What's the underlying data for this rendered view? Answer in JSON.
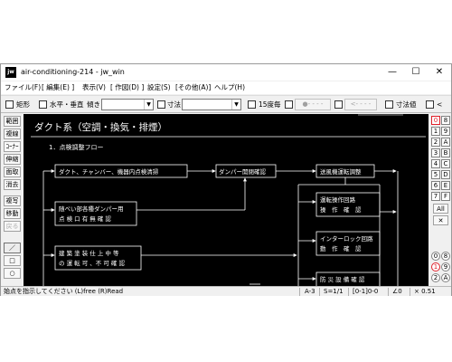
{
  "window": {
    "app_icon": "jw",
    "title": "air-conditioning-214 - jw_win",
    "buttons": {
      "minimize": "—",
      "maximize": "☐",
      "close": "✕"
    }
  },
  "menu": [
    "ファイル(F)",
    "[ 編集(E) ]",
    "表示(V)",
    "[ 作図(D) ]",
    "設定(S)",
    "[その他(A)]",
    "ヘルプ(H)"
  ],
  "toolbar": {
    "rect_label": "矩形",
    "horiz_vert_label": "水平・垂直",
    "tilt_label": "傾き",
    "tilt_value": "",
    "dim_label": "寸法",
    "dim_value": "",
    "scale_label": "15度毎",
    "circle_btn": "●- - - -",
    "arrow_btn": "<- - - -",
    "dim_value_label": "寸法値",
    "lt_label": "<"
  },
  "left_tools": [
    "範囲",
    "複線",
    "ｺｰﾅｰ",
    "伸縮",
    "面取",
    "消去",
    "複写",
    "移動",
    "戻る",
    "／",
    "□",
    "○"
  ],
  "right_tools": {
    "layer_groups_top": [
      "0",
      "1",
      "2",
      "3",
      "4",
      "5",
      "6",
      "7"
    ],
    "layer_groups_right": [
      "8",
      "9",
      "A",
      "B",
      "C",
      "D",
      "E",
      "F"
    ],
    "all_label": "All",
    "x_label": "✕",
    "layers_bottom": [
      "0",
      "8",
      "1",
      "9",
      "2",
      "A"
    ]
  },
  "drawing": {
    "heading": "ダクト系（空調・換気・排煙）",
    "subheading": "1．点検調整フロー",
    "boxes": {
      "duct_check": "ダクト、チャンバー、機器内点検清掃",
      "damper_check": "ダンパー開閉確認",
      "fan_adjust": "送風機運転調整",
      "damper_pos_1": "随べい部各種ダンパー用",
      "damper_pos_2": "点 検 口 有 無 確 認",
      "operation_1": "運転操作回路",
      "operation_2": "操　作　確　認",
      "interlock_1": "インターロック回路",
      "interlock_2": "動　作　確　認",
      "fire_1": "建 築 塗 装 仕 上 中 等",
      "fire_2": "の 運 転 可 、不 可 確 認",
      "lower_1": "防 災 設 備 確 認"
    }
  },
  "status": {
    "message": "始点を指示してください (L)free (R)Read",
    "paper": "A-3",
    "scale": "S=1/1",
    "layer": "[0-1]0-0",
    "angle": "∠0",
    "zoom": "× 0.51"
  }
}
